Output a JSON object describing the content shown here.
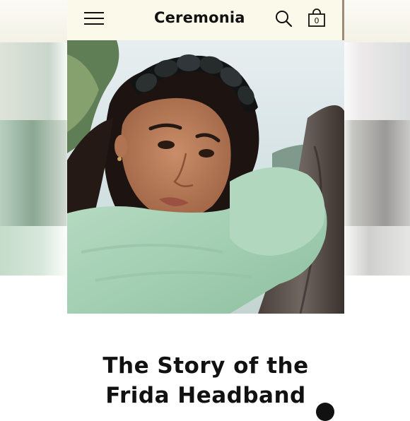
{
  "header": {
    "brand": "Ceremonia",
    "cart_count": "0",
    "menu_icon": "hamburger-menu-icon",
    "search_icon": "search-icon",
    "cart_icon": "shopping-bag-icon"
  },
  "hero": {
    "image_subject": "woman wearing braided black headband and mint sweater"
  },
  "article": {
    "title_line1": "The Story of the",
    "title_line2": "Frida Headband"
  },
  "colors": {
    "header_bg": "#fbf9e9",
    "text": "#111111",
    "sweater": "#a8d3b8"
  }
}
